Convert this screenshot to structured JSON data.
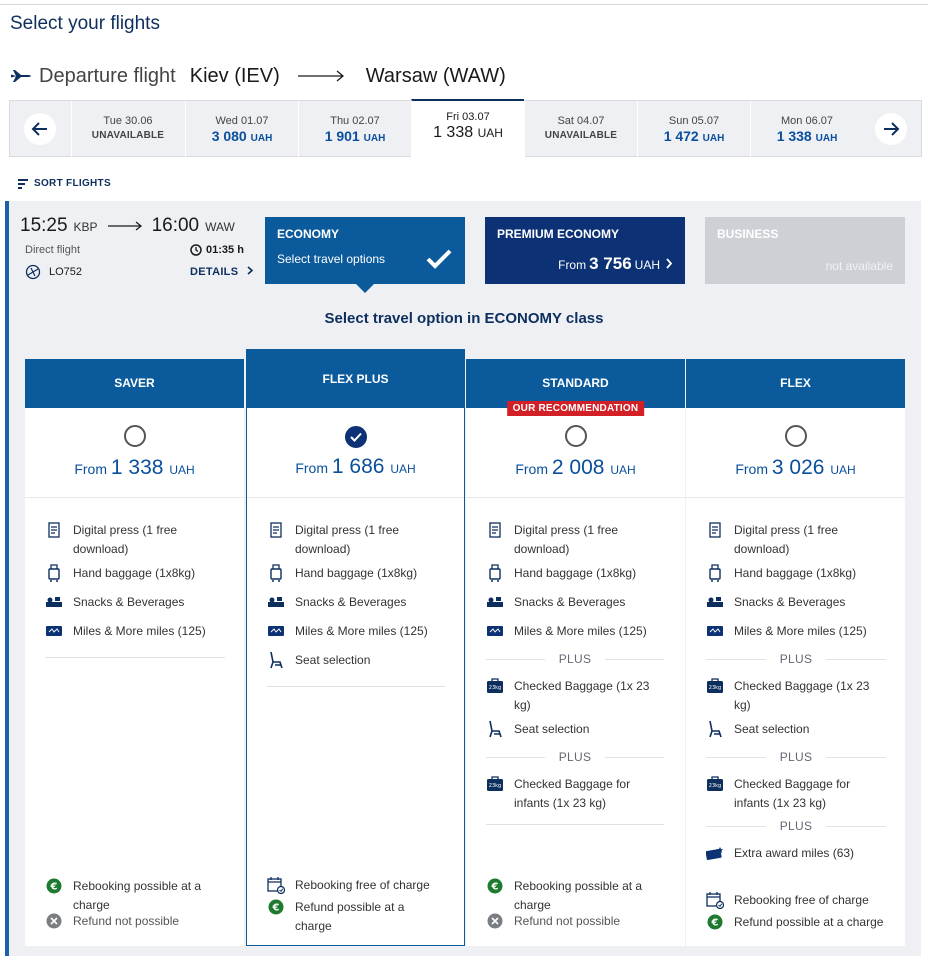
{
  "page": {
    "title": "Select your flights"
  },
  "route": {
    "label": "Departure flight",
    "from": "Kiev (IEV)",
    "to": "Warsaw (WAW)"
  },
  "dates": [
    {
      "date": "Tue 30.06",
      "status": "UNAVAILABLE"
    },
    {
      "date": "Wed 01.07",
      "price": "3 080",
      "currency": "UAH"
    },
    {
      "date": "Thu 02.07",
      "price": "1 901",
      "currency": "UAH"
    },
    {
      "date": "Fri 03.07",
      "price": "1 338",
      "currency": "UAH",
      "selected": true
    },
    {
      "date": "Sat 04.07",
      "status": "UNAVAILABLE"
    },
    {
      "date": "Sun 05.07",
      "price": "1 472",
      "currency": "UAH"
    },
    {
      "date": "Mon 06.07",
      "price": "1 338",
      "currency": "UAH"
    }
  ],
  "sort": {
    "label": "SORT FLIGHTS"
  },
  "flight": {
    "dep_time": "15:25",
    "dep_airport": "KBP",
    "arr_time": "16:00",
    "arr_airport": "WAW",
    "type": "Direct flight",
    "duration": "01:35 h",
    "number": "LO752",
    "details_label": "DETAILS"
  },
  "classes": {
    "economy": {
      "title": "ECONOMY",
      "subtitle": "Select travel options"
    },
    "premium": {
      "title": "PREMIUM ECONOMY",
      "from": "From",
      "price": "3 756",
      "currency": "UAH"
    },
    "business": {
      "title": "BUSINESS",
      "status": "not available"
    }
  },
  "select_option_title": "Select travel option in ECONOMY class",
  "plus_label": "PLUS",
  "recommendation_label": "OUR RECOMMENDATION",
  "fares": [
    {
      "name": "SAVER",
      "from": "From",
      "price": "1 338",
      "currency": "UAH",
      "features": [
        "Digital press (1 free download)",
        "Hand baggage (1x8kg)",
        "Snacks & Beverages",
        "Miles & More miles (125)"
      ],
      "rebooking": "Rebooking possible at a charge",
      "refund": "Refund not possible"
    },
    {
      "name": "FLEX PLUS",
      "from": "From",
      "price": "1 686",
      "currency": "UAH",
      "features": [
        "Digital press (1 free download)",
        "Hand baggage (1x8kg)",
        "Snacks & Beverages",
        "Miles & More miles (125)",
        "Seat selection"
      ],
      "rebooking": "Rebooking free of charge",
      "refund": "Refund possible at a charge"
    },
    {
      "name": "STANDARD",
      "from": "From",
      "price": "2 008",
      "currency": "UAH",
      "features": [
        "Digital press (1 free download)",
        "Hand baggage (1x8kg)",
        "Snacks & Beverages",
        "Miles & More miles (125)"
      ],
      "plus1": [
        "Checked Baggage (1x 23 kg)",
        "Seat selection"
      ],
      "plus2": [
        "Checked Baggage for infants (1x 23 kg)"
      ],
      "rebooking": "Rebooking possible at a charge",
      "refund": "Refund not possible"
    },
    {
      "name": "FLEX",
      "from": "From",
      "price": "3 026",
      "currency": "UAH",
      "features": [
        "Digital press (1 free download)",
        "Hand baggage (1x8kg)",
        "Snacks & Beverages",
        "Miles & More miles (125)"
      ],
      "plus1": [
        "Checked Baggage (1x 23 kg)",
        "Seat selection"
      ],
      "plus2": [
        "Checked Baggage for infants (1x 23 kg)"
      ],
      "plus3": [
        "Extra award miles (63)"
      ],
      "rebooking": "Rebooking free of charge",
      "refund": "Refund possible at a charge"
    }
  ],
  "colors": {
    "primary": "#0a5a9c",
    "navy": "#0c3275",
    "recommend": "#d32027",
    "green": "#1e7a2e"
  }
}
